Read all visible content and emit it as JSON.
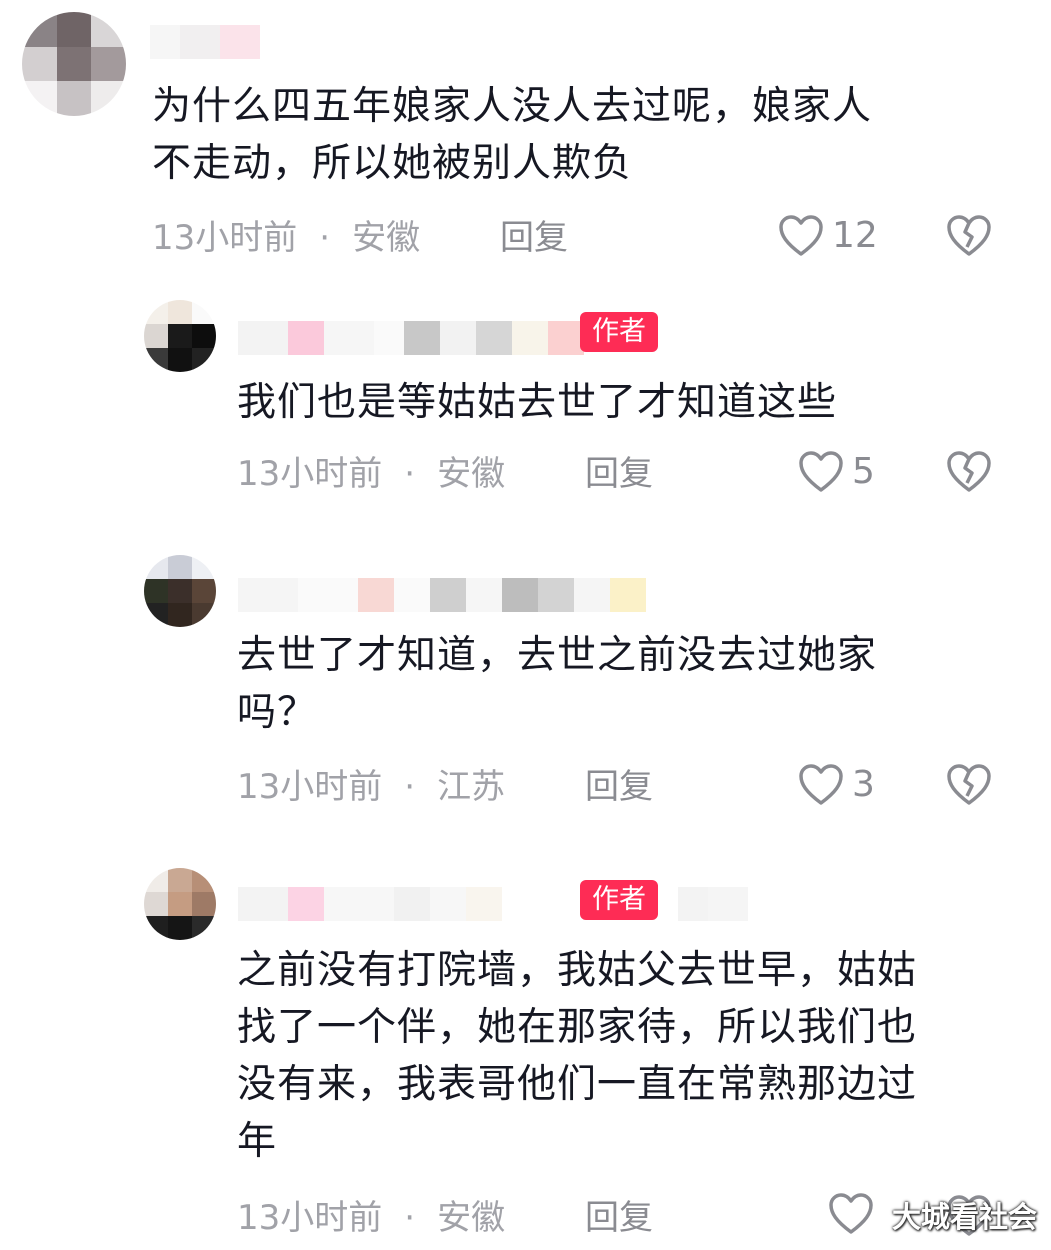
{
  "comments": [
    {
      "text_lines": [
        "为什么四五年娘家人没人去过呢，娘家人",
        "不走动，所以她被别人欺负"
      ],
      "time": "13小时前",
      "dot": "·",
      "region": "安徽",
      "reply_label": "回复",
      "likes": "12",
      "is_author": false
    },
    {
      "text_lines": [
        "我们也是等姑姑去世了才知道这些"
      ],
      "time": "13小时前",
      "dot": "·",
      "region": "安徽",
      "reply_label": "回复",
      "likes": "5",
      "is_author": true,
      "badge": "作者"
    },
    {
      "text_lines": [
        "去世了才知道，去世之前没去过她家",
        "吗？"
      ],
      "time": "13小时前",
      "dot": "·",
      "region": "江苏",
      "reply_label": "回复",
      "likes": "3",
      "is_author": false
    },
    {
      "text_lines": [
        "之前没有打院墙，我姑父去世早，姑姑",
        "找了一个伴，她在那家待，所以我们也",
        "没有来，我表哥他们一直在常熟那边过",
        "年"
      ],
      "time": "13小时前",
      "dot": "·",
      "region": "安徽",
      "reply_label": "回复",
      "likes": "",
      "is_author": true,
      "badge": "作者"
    }
  ],
  "watermark": "大城看社会",
  "icons": {
    "like": "heart-outline-icon",
    "dislike": "broken-heart-icon"
  },
  "colors": {
    "badge": "#fe2c55",
    "meta": "#a1a2a8",
    "text": "#161823"
  }
}
